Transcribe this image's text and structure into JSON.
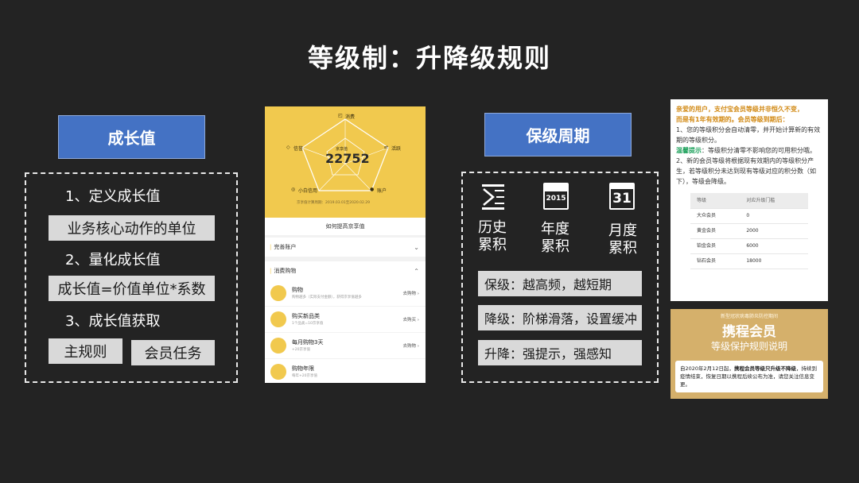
{
  "title": "等级制：升降级规则",
  "left": {
    "header": "成长值",
    "item1": "1、定义成长值",
    "item1_box": "业务核心动作的单位",
    "item2": "2、量化成长值",
    "item2_box": "成长值=价值单位*系数",
    "item3": "3、成长值获取",
    "btn_main": "主规则",
    "btn_task": "会员任务"
  },
  "phone": {
    "consume": "消费",
    "credit": "信誉",
    "active": "活跃",
    "baitiao": "小白信用",
    "account": "账户",
    "label": "京享值",
    "value": "22752",
    "footer": "京享值计算周期：2019.03.01至2020.02.29",
    "improve": "如何提高京享值",
    "complete": "完善账户",
    "shopping": "消费购物",
    "items": [
      {
        "title": "购物",
        "sub": "购物越多（实际支付金额），获得京享值越多",
        "action": "去购物"
      },
      {
        "title": "购买新品类",
        "sub": "1个品类=10京享值",
        "action": "去购买"
      },
      {
        "title": "每月购物3天",
        "sub": "+20京享值",
        "action": "去购物"
      },
      {
        "title": "购物年限",
        "sub": "每年+20京享值",
        "action": ""
      }
    ]
  },
  "middle": {
    "header": "保级周期",
    "icon1_label": "历史\n累积",
    "icon2_label": "年度\n累积",
    "icon3_label": "月度\n累积",
    "calendar_year": "2015",
    "calendar_day": "31",
    "rule1": "保级：越高频，越短期",
    "rule2": "降级：阶梯滑落，设置缓冲",
    "rule3": "升降：强提示，强感知"
  },
  "notice": {
    "line1": "亲爱的用户，支付宝会员等级并非恒久不变，",
    "line2": "而是有1年有效期的。会员等级到期后：",
    "p1": "1、您的等级积分会自动清零，并开始计算新的有效期的等级积分。",
    "tip_label": "温馨提示",
    "tip_text": "：等级积分清零不影响您的可用积分哦。",
    "p2": "2、新的会员等级将根据现有效期内的等级积分产生，若等级积分未达到现有等级对应的积分数（如下），等级会降级。",
    "table_head": [
      "等级",
      "对应升级门槛"
    ],
    "table_rows": [
      [
        "大众会员",
        "0"
      ],
      [
        "黄金会员",
        "2000"
      ],
      [
        "铂金会员",
        "6000"
      ],
      [
        "钻石会员",
        "18000"
      ]
    ]
  },
  "ctrip": {
    "subtitle": "新型冠状病毒肺炎防控期间",
    "title": "携程会员",
    "subtitle2": "等级保护规则说明",
    "text_a": "自2020年2月12日起，",
    "text_b": "携程会员等级只升级不降级",
    "text_c": "，持续到疫情结束，恢复日期以携程后续公布为准，请您关注信息变更。"
  },
  "colors": {
    "background": "#232323",
    "header_blue": "#4472c4",
    "box_gray": "#d9d9d9",
    "phone_yellow": "#f1c94e",
    "ctrip_gold": "#d5b06b"
  }
}
